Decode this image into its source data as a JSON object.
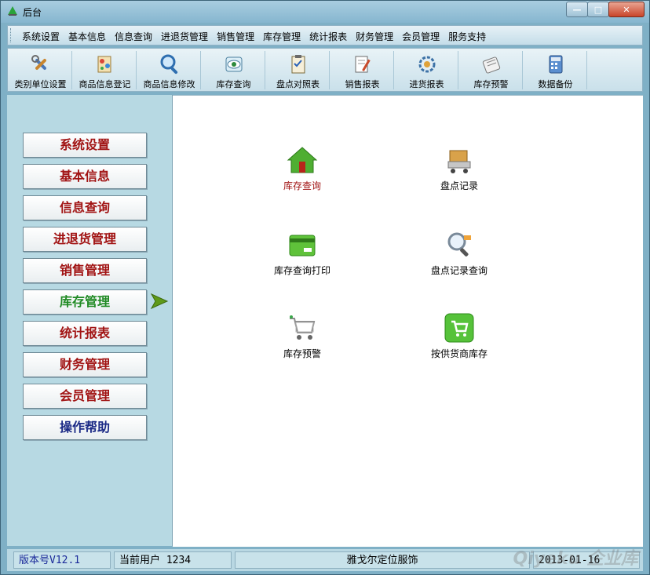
{
  "window": {
    "title": "后台",
    "min_label": "—",
    "max_label": "□",
    "close_label": "✕"
  },
  "menu": [
    "系统设置",
    "基本信息",
    "信息查询",
    "进退货管理",
    "销售管理",
    "库存管理",
    "统计报表",
    "财务管理",
    "会员管理",
    "服务支持"
  ],
  "toolbar": [
    {
      "label": "类别单位设置",
      "icon": "tools-icon"
    },
    {
      "label": "商品信息登记",
      "icon": "product-register-icon"
    },
    {
      "label": "商品信息修改",
      "icon": "magnifier-icon"
    },
    {
      "label": "库存查询",
      "icon": "eye-inspect-icon"
    },
    {
      "label": "盘点对照表",
      "icon": "clipboard-icon"
    },
    {
      "label": "销售报表",
      "icon": "report-pen-icon"
    },
    {
      "label": "进货报表",
      "icon": "gear-chart-icon"
    },
    {
      "label": "库存预警",
      "icon": "warning-paper-icon"
    },
    {
      "label": "数据备份",
      "icon": "calculator-icon"
    }
  ],
  "nav": [
    "系统设置",
    "基本信息",
    "信息查询",
    "进退货管理",
    "销售管理",
    "库存管理",
    "统计报表",
    "财务管理",
    "会员管理",
    "操作帮助"
  ],
  "functions": [
    {
      "label": "库存查询",
      "icon": "house-icon",
      "highlight": true
    },
    {
      "label": "盘点记录",
      "icon": "box-cart-icon"
    },
    {
      "label": "库存查询打印",
      "icon": "card-icon"
    },
    {
      "label": "盘点记录查询",
      "icon": "search-record-icon"
    },
    {
      "label": "库存预警",
      "icon": "shopping-cart-icon"
    },
    {
      "label": "按供货商库存",
      "icon": "green-cart-button-icon"
    }
  ],
  "status": {
    "version": "版本号V12.1",
    "current_user": "当前用户  1234",
    "company": "雅戈尔定位服饰",
    "date": "2013-01-16"
  },
  "watermark": "Qiyeku 企业库",
  "colors": {
    "accent_red": "#a11313",
    "active_green": "#1f8a23",
    "help_blue": "#1b2a86"
  }
}
